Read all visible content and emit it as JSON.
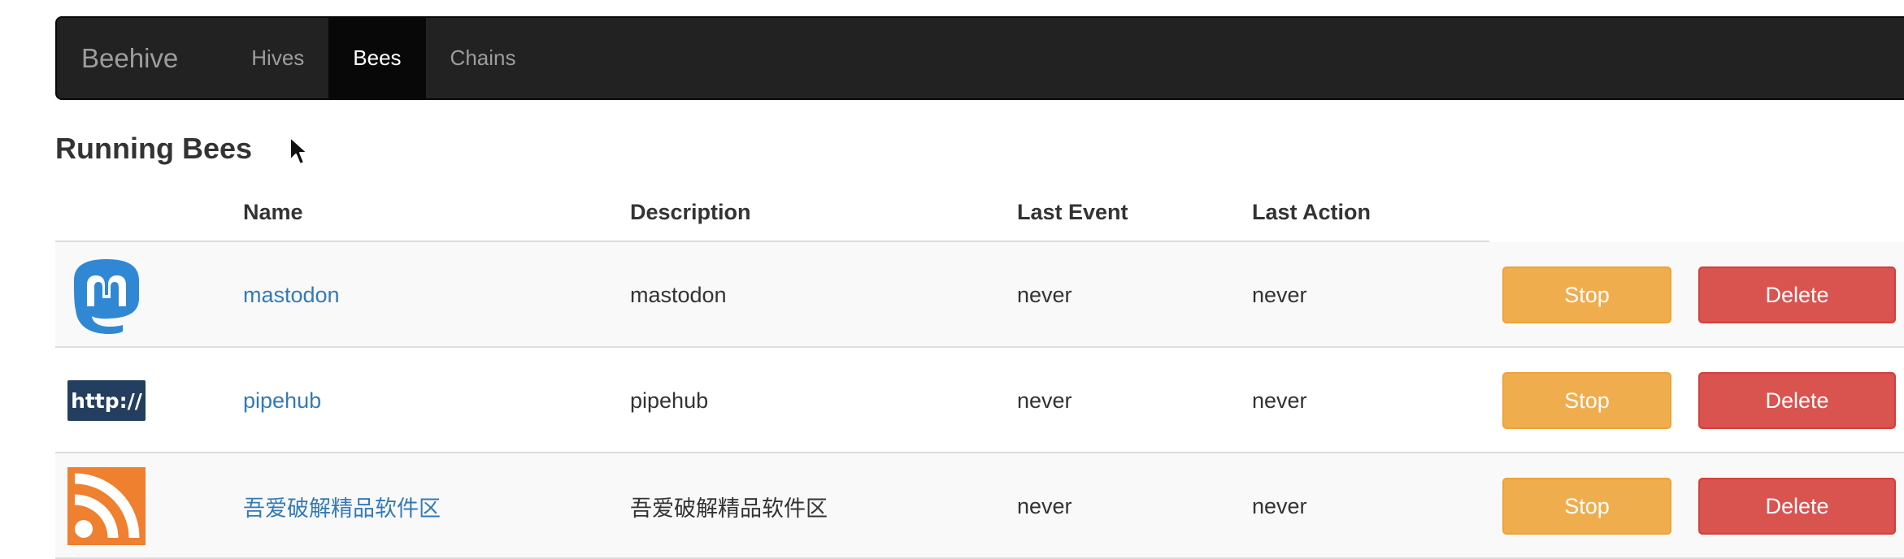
{
  "navbar": {
    "brand": "Beehive",
    "items": [
      {
        "label": "Hives",
        "active": false
      },
      {
        "label": "Bees",
        "active": true
      },
      {
        "label": "Chains",
        "active": false
      }
    ]
  },
  "page": {
    "title": "Running Bees"
  },
  "table": {
    "headers": {
      "name": "Name",
      "description": "Description",
      "last_event": "Last Event",
      "last_action": "Last Action"
    },
    "rows": [
      {
        "icon": "mastodon-icon",
        "name": "mastodon",
        "description": "mastodon",
        "last_event": "never",
        "last_action": "never",
        "stop_label": "Stop",
        "delete_label": "Delete"
      },
      {
        "icon": "http-icon",
        "icon_text": "http://",
        "name": "pipehub",
        "description": "pipehub",
        "last_event": "never",
        "last_action": "never",
        "stop_label": "Stop",
        "delete_label": "Delete"
      },
      {
        "icon": "rss-icon",
        "name": "吾爱破解精品软件区",
        "description": "吾爱破解精品软件区",
        "last_event": "never",
        "last_action": "never",
        "stop_label": "Stop",
        "delete_label": "Delete"
      }
    ]
  },
  "colors": {
    "navbar_bg": "#222222",
    "link": "#337ab7",
    "warning": "#f0ad4e",
    "danger": "#d9534f",
    "mastodon_blue": "#3088d4",
    "http_navy": "#243e5f",
    "rss_orange": "#ee802f"
  }
}
